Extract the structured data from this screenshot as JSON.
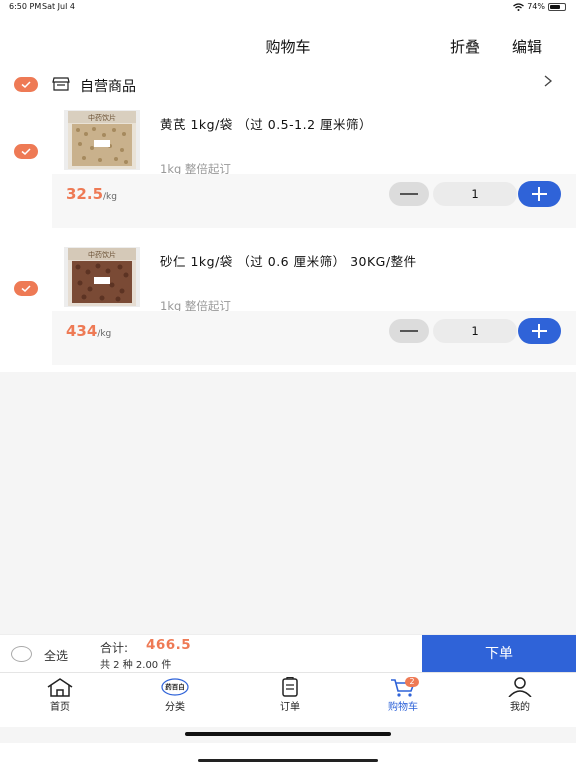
{
  "status": {
    "time": "6:50 PM",
    "date": "Sat Jul 4",
    "battery": "74%",
    "battery_level": 0.74
  },
  "header": {
    "title": "购物车",
    "fold": "折叠",
    "edit": "编辑"
  },
  "store": {
    "name": "自营商品",
    "icon": "store-icon",
    "arrow": "chevron-right-icon"
  },
  "items": [
    {
      "name": "黄芪 1kg/袋 （过 0.5-1.2 厘米筛）",
      "note": "1kg 整倍起订",
      "price": "32.5",
      "unit": "/kg",
      "qty": "1",
      "label": "中药饮片",
      "checked": true
    },
    {
      "name": "砂仁 1kg/袋 （过 0.6 厘米筛） 30KG/整件",
      "note": "1kg 整倍起订",
      "price": "434",
      "unit": "/kg",
      "qty": "1",
      "label": "中药饮片",
      "checked": true
    }
  ],
  "summary": {
    "select_all": "全选",
    "total_label": "合计:",
    "total": "466.5",
    "count": "共 2 种 2.00 件",
    "order": "下单"
  },
  "tabs": [
    {
      "label": "首页",
      "icon": "home-icon"
    },
    {
      "label": "分类",
      "icon": "category-icon",
      "icon_text": "药百白"
    },
    {
      "label": "订单",
      "icon": "order-icon"
    },
    {
      "label": "购物车",
      "icon": "cart-icon",
      "badge": "2",
      "active": true
    },
    {
      "label": "我的",
      "icon": "profile-icon"
    }
  ],
  "colors": {
    "accent": "#2f63d8",
    "orange": "#ee7a55",
    "background": "#f5f5f5"
  }
}
